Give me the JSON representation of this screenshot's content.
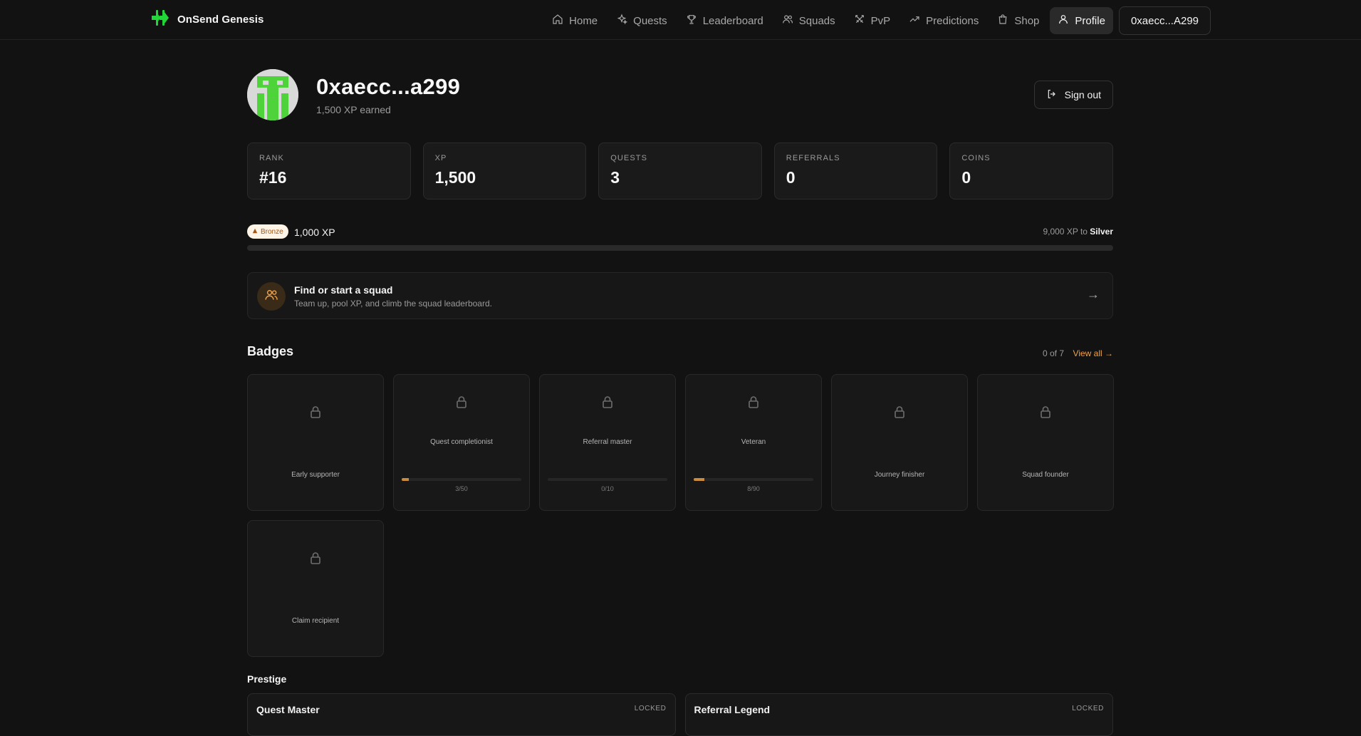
{
  "brand": {
    "name": "OnSend Genesis",
    "accent": "#22d63a"
  },
  "nav": {
    "items": [
      {
        "label": "Home",
        "icon": "home-icon"
      },
      {
        "label": "Quests",
        "icon": "sparkles-icon"
      },
      {
        "label": "Leaderboard",
        "icon": "trophy-icon"
      },
      {
        "label": "Squads",
        "icon": "users-icon"
      },
      {
        "label": "PvP",
        "icon": "swords-icon"
      },
      {
        "label": "Predictions",
        "icon": "trending-up-icon"
      },
      {
        "label": "Shop",
        "icon": "shopping-bag-icon"
      },
      {
        "label": "Profile",
        "icon": "user-icon",
        "active": true
      }
    ],
    "wallet": "0xaecc...A299"
  },
  "profile": {
    "name": "0xaecc...a299",
    "xp_earned": "1,500 XP earned",
    "sign_out": "Sign out"
  },
  "stats": [
    {
      "label": "RANK",
      "value": "#16"
    },
    {
      "label": "XP",
      "value": "1,500"
    },
    {
      "label": "QUESTS",
      "value": "3"
    },
    {
      "label": "REFERRALS",
      "value": "0"
    },
    {
      "label": "COINS",
      "value": "0"
    }
  ],
  "tier": {
    "badge": "Bronze",
    "xp": "1,000 XP",
    "next_prefix": "9,000 XP to",
    "next_tier": "Silver",
    "progress": 0,
    "accent": "#f0a24a"
  },
  "squad_cta": {
    "title": "Find or start a squad",
    "subtitle": "Team up, pool XP, and climb the squad leaderboard.",
    "arrow": "→"
  },
  "badges": {
    "title": "Badges",
    "count": "0 of 7",
    "view_all": "View all →",
    "items": [
      {
        "name": "Early supporter"
      },
      {
        "name": "Quest completionist",
        "progress": "3/50",
        "fraction": 0.06
      },
      {
        "name": "Referral master",
        "progress": "0/10",
        "fraction": 0
      },
      {
        "name": "Veteran",
        "progress": "8/90",
        "fraction": 0.09
      },
      {
        "name": "Journey finisher"
      },
      {
        "name": "Squad founder"
      },
      {
        "name": "Claim recipient"
      }
    ]
  },
  "prestige": {
    "title": "Prestige",
    "cards": [
      {
        "name": "Quest Master",
        "status": "LOCKED"
      },
      {
        "name": "Referral Legend",
        "status": "LOCKED"
      }
    ]
  }
}
